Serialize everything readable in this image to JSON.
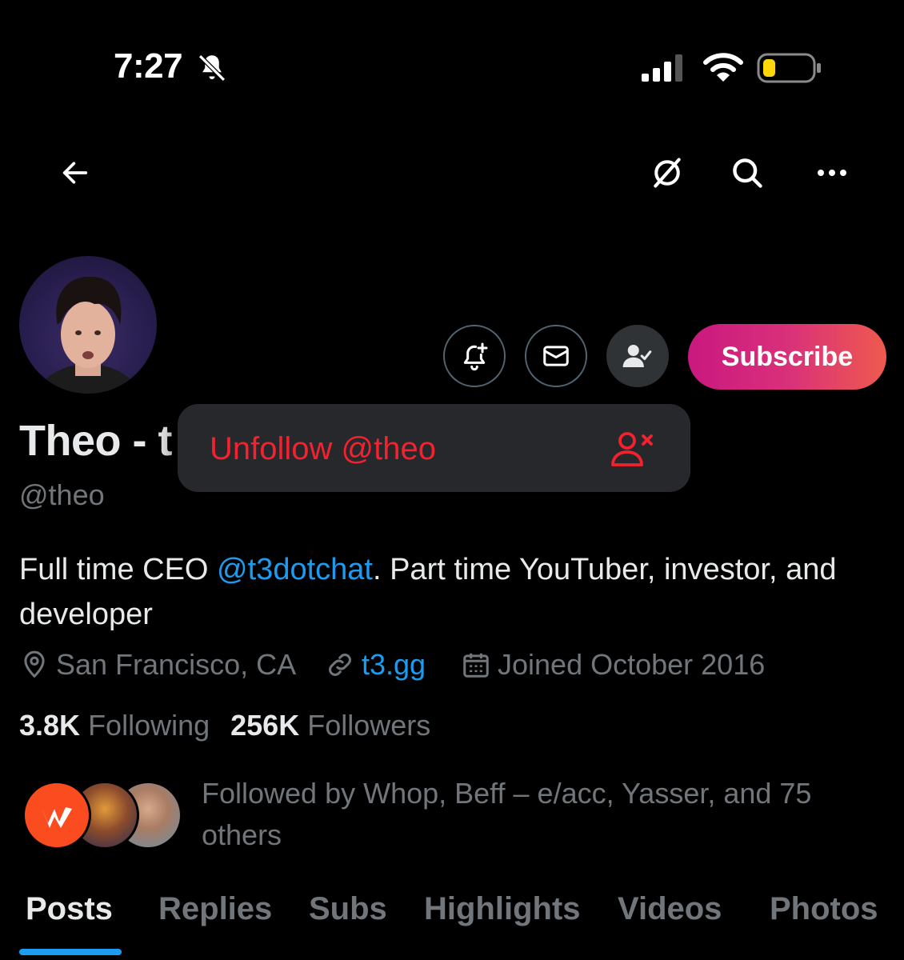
{
  "status_bar": {
    "time": "7:27",
    "icons": [
      "bell-muted-icon",
      "cellular-signal-icon",
      "wifi-icon",
      "battery-low-icon"
    ]
  },
  "nav": {
    "icons": [
      "back-arrow-icon",
      "grok-icon",
      "search-icon",
      "more-icon"
    ]
  },
  "profile": {
    "display_name": "Theo - t",
    "handle": "@theo",
    "bio_prefix": "Full time CEO ",
    "bio_mention": "@t3dotchat",
    "bio_suffix": ". Part time YouTuber, investor, and developer",
    "location": "San Francisco, CA",
    "website": "t3.gg",
    "joined": "Joined October 2016",
    "following_count": "3.8K",
    "following_label": "Following",
    "followers_count": "256K",
    "followers_label": "Followers",
    "followed_by": "Followed by Whop, Beff – e/acc, Yasser, and 75 others"
  },
  "actions": {
    "subscribe_label": "Subscribe",
    "accent_gradient": [
      "#c9187f",
      "#ee5a4e"
    ]
  },
  "popup": {
    "label": "Unfollow @theo",
    "color": "#f4212e"
  },
  "tabs": [
    {
      "label": "Posts",
      "active": true
    },
    {
      "label": "Replies",
      "active": false
    },
    {
      "label": "Subs",
      "active": false
    },
    {
      "label": "Highlights",
      "active": false
    },
    {
      "label": "Videos",
      "active": false
    },
    {
      "label": "Photos",
      "active": false
    }
  ],
  "colors": {
    "background": "#000000",
    "link": "#1d9bf0",
    "muted": "#71767b",
    "text": "#e7e9ea"
  }
}
